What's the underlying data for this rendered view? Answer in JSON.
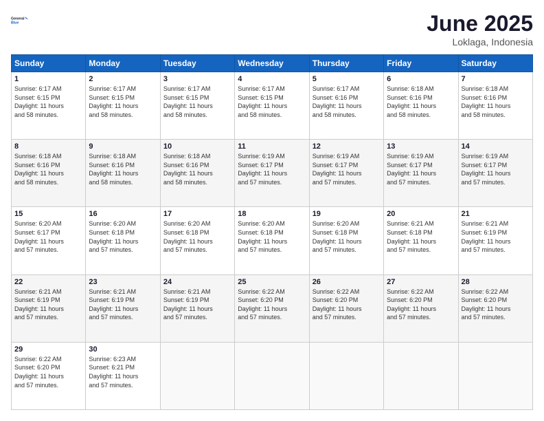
{
  "logo": {
    "line1": "General",
    "line2": "Blue"
  },
  "title": "June 2025",
  "location": "Loklaga, Indonesia",
  "days_header": [
    "Sunday",
    "Monday",
    "Tuesday",
    "Wednesday",
    "Thursday",
    "Friday",
    "Saturday"
  ],
  "weeks": [
    [
      {
        "day": "1",
        "sunrise": "6:17 AM",
        "sunset": "6:15 PM",
        "daylight": "11 hours and 58 minutes."
      },
      {
        "day": "2",
        "sunrise": "6:17 AM",
        "sunset": "6:15 PM",
        "daylight": "11 hours and 58 minutes."
      },
      {
        "day": "3",
        "sunrise": "6:17 AM",
        "sunset": "6:15 PM",
        "daylight": "11 hours and 58 minutes."
      },
      {
        "day": "4",
        "sunrise": "6:17 AM",
        "sunset": "6:15 PM",
        "daylight": "11 hours and 58 minutes."
      },
      {
        "day": "5",
        "sunrise": "6:17 AM",
        "sunset": "6:16 PM",
        "daylight": "11 hours and 58 minutes."
      },
      {
        "day": "6",
        "sunrise": "6:18 AM",
        "sunset": "6:16 PM",
        "daylight": "11 hours and 58 minutes."
      },
      {
        "day": "7",
        "sunrise": "6:18 AM",
        "sunset": "6:16 PM",
        "daylight": "11 hours and 58 minutes."
      }
    ],
    [
      {
        "day": "8",
        "sunrise": "6:18 AM",
        "sunset": "6:16 PM",
        "daylight": "11 hours and 58 minutes."
      },
      {
        "day": "9",
        "sunrise": "6:18 AM",
        "sunset": "6:16 PM",
        "daylight": "11 hours and 58 minutes."
      },
      {
        "day": "10",
        "sunrise": "6:18 AM",
        "sunset": "6:16 PM",
        "daylight": "11 hours and 58 minutes."
      },
      {
        "day": "11",
        "sunrise": "6:19 AM",
        "sunset": "6:17 PM",
        "daylight": "11 hours and 57 minutes."
      },
      {
        "day": "12",
        "sunrise": "6:19 AM",
        "sunset": "6:17 PM",
        "daylight": "11 hours and 57 minutes."
      },
      {
        "day": "13",
        "sunrise": "6:19 AM",
        "sunset": "6:17 PM",
        "daylight": "11 hours and 57 minutes."
      },
      {
        "day": "14",
        "sunrise": "6:19 AM",
        "sunset": "6:17 PM",
        "daylight": "11 hours and 57 minutes."
      }
    ],
    [
      {
        "day": "15",
        "sunrise": "6:20 AM",
        "sunset": "6:17 PM",
        "daylight": "11 hours and 57 minutes."
      },
      {
        "day": "16",
        "sunrise": "6:20 AM",
        "sunset": "6:18 PM",
        "daylight": "11 hours and 57 minutes."
      },
      {
        "day": "17",
        "sunrise": "6:20 AM",
        "sunset": "6:18 PM",
        "daylight": "11 hours and 57 minutes."
      },
      {
        "day": "18",
        "sunrise": "6:20 AM",
        "sunset": "6:18 PM",
        "daylight": "11 hours and 57 minutes."
      },
      {
        "day": "19",
        "sunrise": "6:20 AM",
        "sunset": "6:18 PM",
        "daylight": "11 hours and 57 minutes."
      },
      {
        "day": "20",
        "sunrise": "6:21 AM",
        "sunset": "6:18 PM",
        "daylight": "11 hours and 57 minutes."
      },
      {
        "day": "21",
        "sunrise": "6:21 AM",
        "sunset": "6:19 PM",
        "daylight": "11 hours and 57 minutes."
      }
    ],
    [
      {
        "day": "22",
        "sunrise": "6:21 AM",
        "sunset": "6:19 PM",
        "daylight": "11 hours and 57 minutes."
      },
      {
        "day": "23",
        "sunrise": "6:21 AM",
        "sunset": "6:19 PM",
        "daylight": "11 hours and 57 minutes."
      },
      {
        "day": "24",
        "sunrise": "6:21 AM",
        "sunset": "6:19 PM",
        "daylight": "11 hours and 57 minutes."
      },
      {
        "day": "25",
        "sunrise": "6:22 AM",
        "sunset": "6:20 PM",
        "daylight": "11 hours and 57 minutes."
      },
      {
        "day": "26",
        "sunrise": "6:22 AM",
        "sunset": "6:20 PM",
        "daylight": "11 hours and 57 minutes."
      },
      {
        "day": "27",
        "sunrise": "6:22 AM",
        "sunset": "6:20 PM",
        "daylight": "11 hours and 57 minutes."
      },
      {
        "day": "28",
        "sunrise": "6:22 AM",
        "sunset": "6:20 PM",
        "daylight": "11 hours and 57 minutes."
      }
    ],
    [
      {
        "day": "29",
        "sunrise": "6:22 AM",
        "sunset": "6:20 PM",
        "daylight": "11 hours and 57 minutes."
      },
      {
        "day": "30",
        "sunrise": "6:23 AM",
        "sunset": "6:21 PM",
        "daylight": "11 hours and 57 minutes."
      },
      null,
      null,
      null,
      null,
      null
    ]
  ],
  "labels": {
    "sunrise": "Sunrise:",
    "sunset": "Sunset:",
    "daylight": "Daylight:"
  }
}
